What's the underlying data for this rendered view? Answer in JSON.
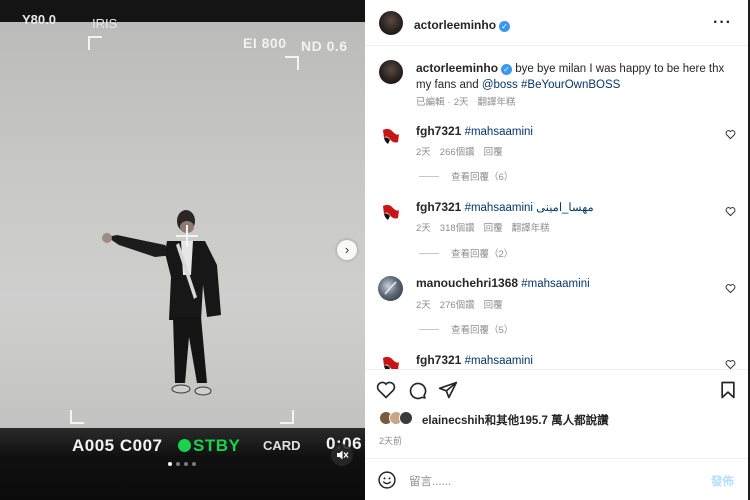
{
  "media": {
    "hud_top_left": "Y80.0",
    "hud_iris": "IRIS",
    "hud_ei": "EI 800",
    "hud_nd": "ND 0.6",
    "hud_clip": "A005 C007",
    "hud_stby": "STBY",
    "hud_card": "CARD",
    "hud_timecode": "0:06",
    "slide_count": 4,
    "active_slide": 1,
    "muted": true
  },
  "post": {
    "author": "actorleeminho",
    "verified": true,
    "caption": {
      "username": "actorleeminho",
      "text": "bye bye milan I was happy to be here thx my fans and ",
      "mention": "@boss",
      "hashtag": "#BeYourOwnBOSS",
      "edited": "已編輯",
      "separator": "·",
      "age": "2天",
      "translate": "翻譯年糕"
    },
    "comments": [
      {
        "username": "fgh7321",
        "text": "#mahsaamini",
        "age": "2天",
        "likes": "266個讚",
        "reply": "回覆",
        "translate": "",
        "view_replies": "查看回覆（6）"
      },
      {
        "username": "fgh7321",
        "text": "#mahsaamini مهسا_امینی",
        "age": "2天",
        "likes": "318個讚",
        "reply": "回覆",
        "translate": "翻譯年糕",
        "view_replies": "查看回覆（2）"
      },
      {
        "username": "manouchehri1368",
        "text": "#mahsaamini",
        "age": "2天",
        "likes": "276個讚",
        "reply": "回覆",
        "translate": "",
        "view_replies": "查看回覆（5）"
      },
      {
        "username": "fgh7321",
        "text": "#mahsaamini",
        "age": "",
        "likes": "",
        "reply": "",
        "translate": "",
        "view_replies": ""
      }
    ],
    "likes_user": "elainecshih",
    "likes_text": "和其他195.7 萬人都說讚",
    "posted_time": "2天前",
    "comment_placeholder": "留言......",
    "post_button": "發佈"
  },
  "colors": {
    "link": "#00376b",
    "verified": "#3897f0",
    "stby": "#19d44a",
    "post_button": "#b2dffc"
  }
}
